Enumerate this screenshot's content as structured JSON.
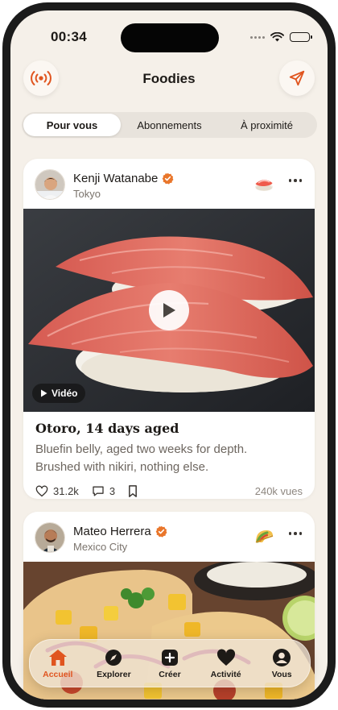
{
  "status_bar": {
    "time": "00:34"
  },
  "header": {
    "title": "Foodies",
    "left_icon": "live-broadcast-icon",
    "right_icon": "send-icon"
  },
  "tabs": [
    {
      "label": "Pour vous",
      "active": true
    },
    {
      "label": "Abonnements",
      "active": false
    },
    {
      "label": "À proximité",
      "active": false
    }
  ],
  "posts": [
    {
      "author": "Kenji Watanabe",
      "location": "Tokyo",
      "verified": true,
      "badge": "sushi-emoji",
      "media_type": "video",
      "video_label": "Vidéo",
      "title": "Otoro, 14 days aged",
      "description": "Bluefin belly, aged two weeks for depth. Brushed with nikiri, nothing else.",
      "likes": "31.2k",
      "comments": "3",
      "views": "240k vues"
    },
    {
      "author": "Mateo Herrera",
      "location": "Mexico City",
      "verified": true,
      "badge": "taco-emoji"
    }
  ],
  "nav": [
    {
      "label": "Accueil",
      "icon": "home-icon",
      "active": true
    },
    {
      "label": "Explorer",
      "icon": "compass-icon",
      "active": false
    },
    {
      "label": "Créer",
      "icon": "plus-square-icon",
      "active": false
    },
    {
      "label": "Activité",
      "icon": "heart-icon",
      "active": false
    },
    {
      "label": "Vous",
      "icon": "profile-icon",
      "active": false
    }
  ],
  "colors": {
    "accent": "#e0551f",
    "background": "#f5f0e9",
    "verified": "#e9762b"
  }
}
